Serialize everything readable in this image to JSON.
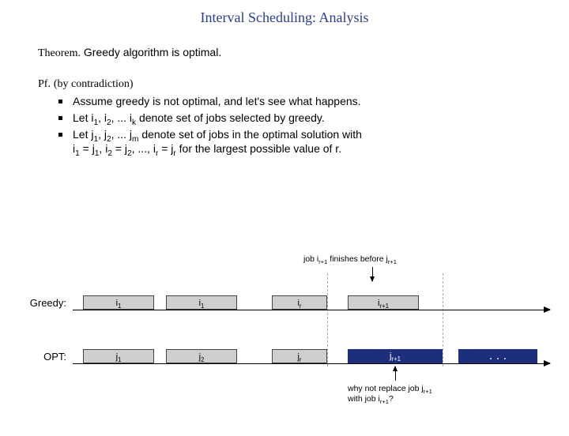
{
  "title": "Interval Scheduling:  Analysis",
  "theorem_label": "Theorem.",
  "theorem_text": "Greedy algorithm is optimal.",
  "pf_label": "Pf.",
  "pf_method": "(by contradiction)",
  "bullets": {
    "b1": "Assume greedy is not optimal, and let's see what happens.",
    "b2_pre": "Let i",
    "b2_mid1": ", i",
    "b2_mid2": ", ... i",
    "b2_post": " denote set of jobs selected by greedy.",
    "b3_pre": "Let j",
    "b3_mid1": ", j",
    "b3_mid2": ", ... j",
    "b3_line2a": " denote set of jobs in the optimal solution with",
    "b3_line2b_pre": "i",
    "b3_eq": " = j",
    "b3_comma": ", i",
    "b3_eq2": " = j",
    "b3_dots": ", ..., i",
    "b3_eq3": " = j",
    "b3_tail": " for the largest possible value of r."
  },
  "sub": {
    "1": "1",
    "2": "2",
    "k": "k",
    "m": "m",
    "r": "r",
    "rp1": "r+1"
  },
  "note_top_a": "job i",
  "note_top_b": " finishes before j",
  "row_greedy": "Greedy:",
  "row_opt": "OPT:",
  "bars": {
    "g1": "i",
    "g2": "i",
    "gr": "i",
    "grp1": "i",
    "o1": "j",
    "o2": "j",
    "or": "j",
    "orp1": "j"
  },
  "note_bot_a": "why not replace job j",
  "note_bot_b": "with job i",
  "note_bot_c": "?",
  "dots": ". . ."
}
